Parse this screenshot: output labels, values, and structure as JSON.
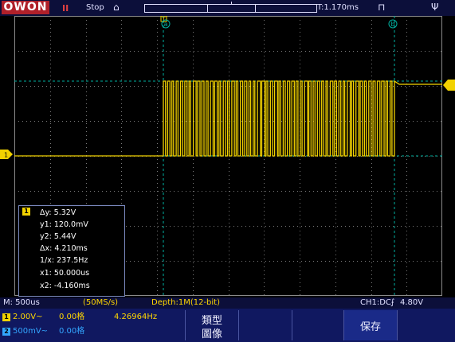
{
  "topbar": {
    "brand": "OWON",
    "run_icon": "II",
    "run_state": "Stop",
    "home_icon": "home-icon",
    "trigger_position": "T:1.170ms",
    "lock_icon": "lock-icon",
    "usb_icon": "usb-icon"
  },
  "markers": {
    "cursor_a": "a",
    "cursor_b": "b",
    "trigger": "T"
  },
  "cursor_box": {
    "channel": "1",
    "dy": "Δy: 5.32V",
    "y1": "y1: 120.0mV",
    "y2": "y2: 5.44V",
    "dx": "Δx: 4.210ms",
    "inv_dx": "1/x: 237.5Hz",
    "x1": "x1: 50.000us",
    "x2": "x2: -4.160ms"
  },
  "statusbar": {
    "timebase": "M: 500us",
    "sample_rate": "(50MS/s)",
    "depth": "Depth:1M(12-bit)",
    "trigger": "CH1:DC-",
    "trigger_level": "4.80V"
  },
  "channels": [
    {
      "num": "1",
      "scale": "2.00V~",
      "pos": "0.00格",
      "freq": "4.26964Hz",
      "color": "#f2d200"
    },
    {
      "num": "2",
      "scale": "500mV~",
      "pos": "0.00格",
      "freq": "",
      "color": "#33a6ff"
    }
  ],
  "softkeys": {
    "type_line1": "類型",
    "type_line2": "圖像",
    "save": "保存"
  },
  "colors": {
    "trace": "#f2d200",
    "grid": "#7a7a7a",
    "cursor_line": "#00b0a0"
  },
  "waveform": {
    "low_level_v": 0.12,
    "high_level_v": 5.44,
    "pulse_count": 54
  }
}
